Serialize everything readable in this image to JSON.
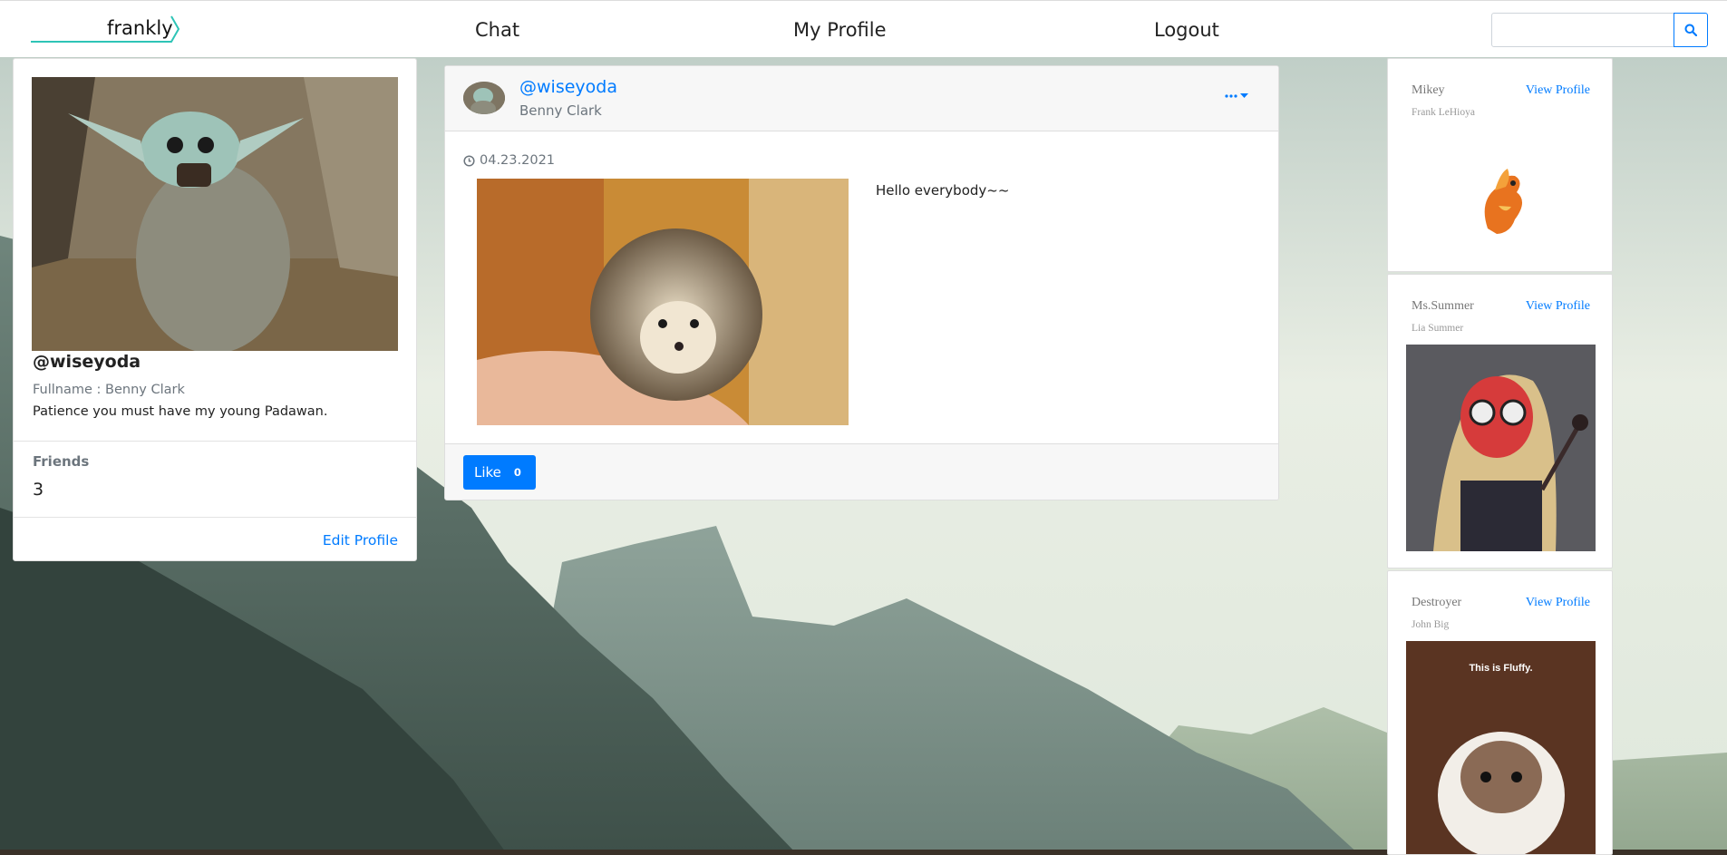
{
  "nav": {
    "brand": "frankly",
    "links": [
      "Chat",
      "My Profile",
      "Logout"
    ],
    "search_placeholder": "",
    "search_icon": "search-icon"
  },
  "profile": {
    "handle": "@wiseyoda",
    "fullname": "Fullname : Benny Clark",
    "bio": "Patience you must have my young Padawan.",
    "friends_label": "Friends",
    "friends_count": "3",
    "edit_label": "Edit Profile"
  },
  "post": {
    "handle": "@wiseyoda",
    "name": "Benny Clark",
    "menu_icon": "more-dropdown-icon",
    "date": "04.23.2021",
    "date_icon": "clock-icon",
    "text": "Hello everybody~~",
    "like_label": "Like",
    "like_count": "0"
  },
  "friends": [
    {
      "nickname": "Mikey",
      "fullname": "Frank LeHioya",
      "view_label": "View Profile"
    },
    {
      "nickname": "Ms.Summer",
      "fullname": "Lia Summer",
      "view_label": "View Profile"
    },
    {
      "nickname": "Destroyer",
      "fullname": "John Big",
      "view_label": "View Profile",
      "image_caption": "This is Fluffy."
    }
  ],
  "colors": {
    "primary": "#007bff",
    "brand_accent": "#2ec4b6"
  }
}
